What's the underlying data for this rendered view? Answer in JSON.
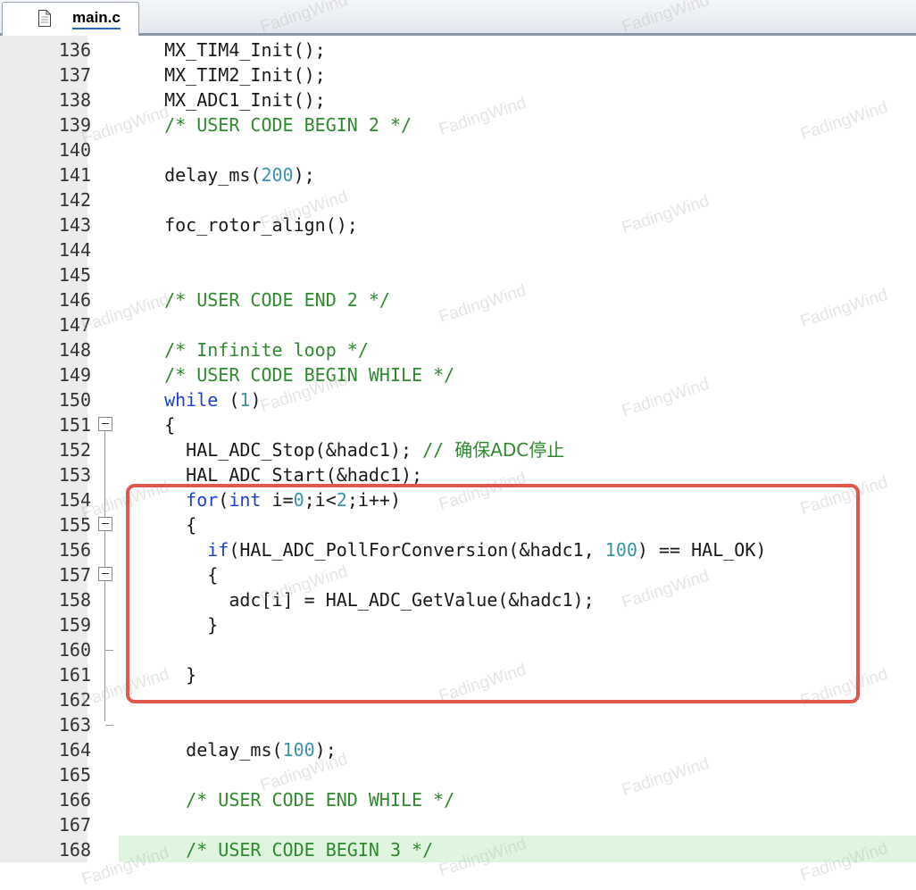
{
  "tab": {
    "filename": "main.c",
    "icon": "file-icon"
  },
  "watermark": "FadingWind",
  "colors": {
    "comment": "#2f8a2f",
    "keyword": "#1c3fd6",
    "number": "#3a93ae",
    "highlight": "#e2574c",
    "current_line": "#dff5df"
  },
  "lines": [
    {
      "n": "136",
      "t": [
        {
          "c": "  MX_TIM4_Init();"
        }
      ]
    },
    {
      "n": "137",
      "t": [
        {
          "c": "  MX_TIM2_Init();"
        }
      ]
    },
    {
      "n": "138",
      "t": [
        {
          "c": "  MX_ADC1_Init();"
        }
      ]
    },
    {
      "n": "139",
      "t": [
        {
          "c": "  "
        },
        {
          "c": "/* USER CODE BEGIN 2 */",
          "k": "comment"
        }
      ]
    },
    {
      "n": "140",
      "t": []
    },
    {
      "n": "141",
      "t": [
        {
          "c": "  delay_ms("
        },
        {
          "c": "200",
          "k": "number"
        },
        {
          "c": ");"
        }
      ]
    },
    {
      "n": "142",
      "t": []
    },
    {
      "n": "143",
      "t": [
        {
          "c": "  foc_rotor_align();"
        }
      ]
    },
    {
      "n": "144",
      "t": []
    },
    {
      "n": "145",
      "t": []
    },
    {
      "n": "146",
      "t": [
        {
          "c": "  "
        },
        {
          "c": "/* USER CODE END 2 */",
          "k": "comment"
        }
      ]
    },
    {
      "n": "147",
      "t": []
    },
    {
      "n": "148",
      "t": [
        {
          "c": "  "
        },
        {
          "c": "/* Infinite loop */",
          "k": "comment"
        }
      ]
    },
    {
      "n": "149",
      "t": [
        {
          "c": "  "
        },
        {
          "c": "/* USER CODE BEGIN WHILE */",
          "k": "comment"
        }
      ]
    },
    {
      "n": "150",
      "t": [
        {
          "c": "  "
        },
        {
          "c": "while",
          "k": "keyword"
        },
        {
          "c": " ("
        },
        {
          "c": "1",
          "k": "number"
        },
        {
          "c": ")"
        }
      ]
    },
    {
      "n": "151",
      "t": [
        {
          "c": "  {"
        }
      ]
    },
    {
      "n": "152",
      "t": [
        {
          "c": "    HAL_ADC_Stop(&hadc1); "
        },
        {
          "c": "// ",
          "k": "comment"
        },
        {
          "c": "确保ADC停止",
          "k": "cjk"
        }
      ]
    },
    {
      "n": "153",
      "t": [
        {
          "c": "    HAL_ADC_Start(&hadc1);"
        }
      ]
    },
    {
      "n": "154",
      "t": [
        {
          "c": "    "
        },
        {
          "c": "for",
          "k": "keyword"
        },
        {
          "c": "("
        },
        {
          "c": "int",
          "k": "keyword"
        },
        {
          "c": " i="
        },
        {
          "c": "0",
          "k": "number"
        },
        {
          "c": ";i<"
        },
        {
          "c": "2",
          "k": "number"
        },
        {
          "c": ";i++)"
        }
      ]
    },
    {
      "n": "155",
      "t": [
        {
          "c": "    {"
        }
      ]
    },
    {
      "n": "156",
      "t": [
        {
          "c": "      "
        },
        {
          "c": "if",
          "k": "keyword"
        },
        {
          "c": "(HAL_ADC_PollForConversion(&hadc1, "
        },
        {
          "c": "100",
          "k": "number"
        },
        {
          "c": ") == HAL_OK)"
        }
      ]
    },
    {
      "n": "157",
      "t": [
        {
          "c": "      {"
        }
      ]
    },
    {
      "n": "158",
      "t": [
        {
          "c": "        adc[i] = HAL_ADC_GetValue(&hadc1);"
        }
      ]
    },
    {
      "n": "159",
      "t": [
        {
          "c": "      }"
        }
      ]
    },
    {
      "n": "160",
      "t": []
    },
    {
      "n": "161",
      "t": [
        {
          "c": "    }"
        }
      ]
    },
    {
      "n": "162",
      "t": []
    },
    {
      "n": "163",
      "t": []
    },
    {
      "n": "164",
      "t": [
        {
          "c": "    delay_ms("
        },
        {
          "c": "100",
          "k": "number"
        },
        {
          "c": ");"
        }
      ]
    },
    {
      "n": "165",
      "t": []
    },
    {
      "n": "166",
      "t": [
        {
          "c": "    "
        },
        {
          "c": "/* USER CODE END WHILE */",
          "k": "comment"
        }
      ]
    },
    {
      "n": "167",
      "t": []
    },
    {
      "n": "168",
      "t": [
        {
          "c": "    "
        },
        {
          "c": "/* USER CODE BEGIN 3 */",
          "k": "comment"
        }
      ]
    }
  ]
}
